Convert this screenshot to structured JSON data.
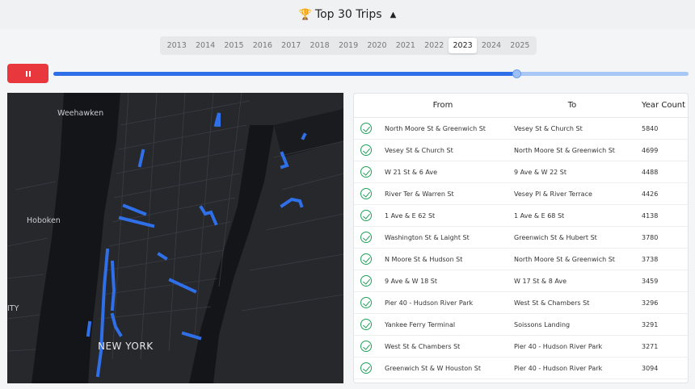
{
  "header": {
    "title": "Top 30 Trips",
    "trophy_icon": "trophy-icon",
    "toggle_icon": "chevron-up-icon"
  },
  "years": [
    "2013",
    "2014",
    "2015",
    "2016",
    "2017",
    "2018",
    "2019",
    "2020",
    "2021",
    "2022",
    "2023",
    "2024",
    "2025"
  ],
  "selected_year": "2023",
  "controls": {
    "pause_icon": "pause-icon",
    "accent": "#e8383d",
    "slider_progress": 0.73
  },
  "map": {
    "labels": {
      "weehawken": "Weehawken",
      "hoboken": "Hoboken",
      "new_york": "NEW YORK",
      "jersey_city_fragment": "ITY"
    },
    "route_color": "#2f6fe8"
  },
  "table": {
    "headers": {
      "from": "From",
      "to": "To",
      "count": "Year Count"
    },
    "rows": [
      {
        "from": "North Moore St & Greenwich St",
        "to": "Vesey St & Church St",
        "count": "5840"
      },
      {
        "from": "Vesey St & Church St",
        "to": "North Moore St & Greenwich St",
        "count": "4699"
      },
      {
        "from": "W 21 St & 6 Ave",
        "to": "9 Ave & W 22 St",
        "count": "4488"
      },
      {
        "from": "River Ter & Warren St",
        "to": "Vesey Pl & River Terrace",
        "count": "4426"
      },
      {
        "from": "1 Ave & E 62 St",
        "to": "1 Ave & E 68 St",
        "count": "4138"
      },
      {
        "from": "Washington St & Laight St",
        "to": "Greenwich St & Hubert St",
        "count": "3780"
      },
      {
        "from": "N Moore St & Hudson St",
        "to": "North Moore St & Greenwich St",
        "count": "3738"
      },
      {
        "from": "9 Ave & W 18 St",
        "to": "W 17 St & 8 Ave",
        "count": "3459"
      },
      {
        "from": "Pier 40 - Hudson River Park",
        "to": "West St & Chambers St",
        "count": "3296"
      },
      {
        "from": "Yankee Ferry Terminal",
        "to": "Soissons Landing",
        "count": "3291"
      },
      {
        "from": "West St & Chambers St",
        "to": "Pier 40 - Hudson River Park",
        "count": "3271"
      },
      {
        "from": "Greenwich St & W Houston St",
        "to": "Pier 40 - Hudson River Park",
        "count": "3094"
      }
    ]
  }
}
